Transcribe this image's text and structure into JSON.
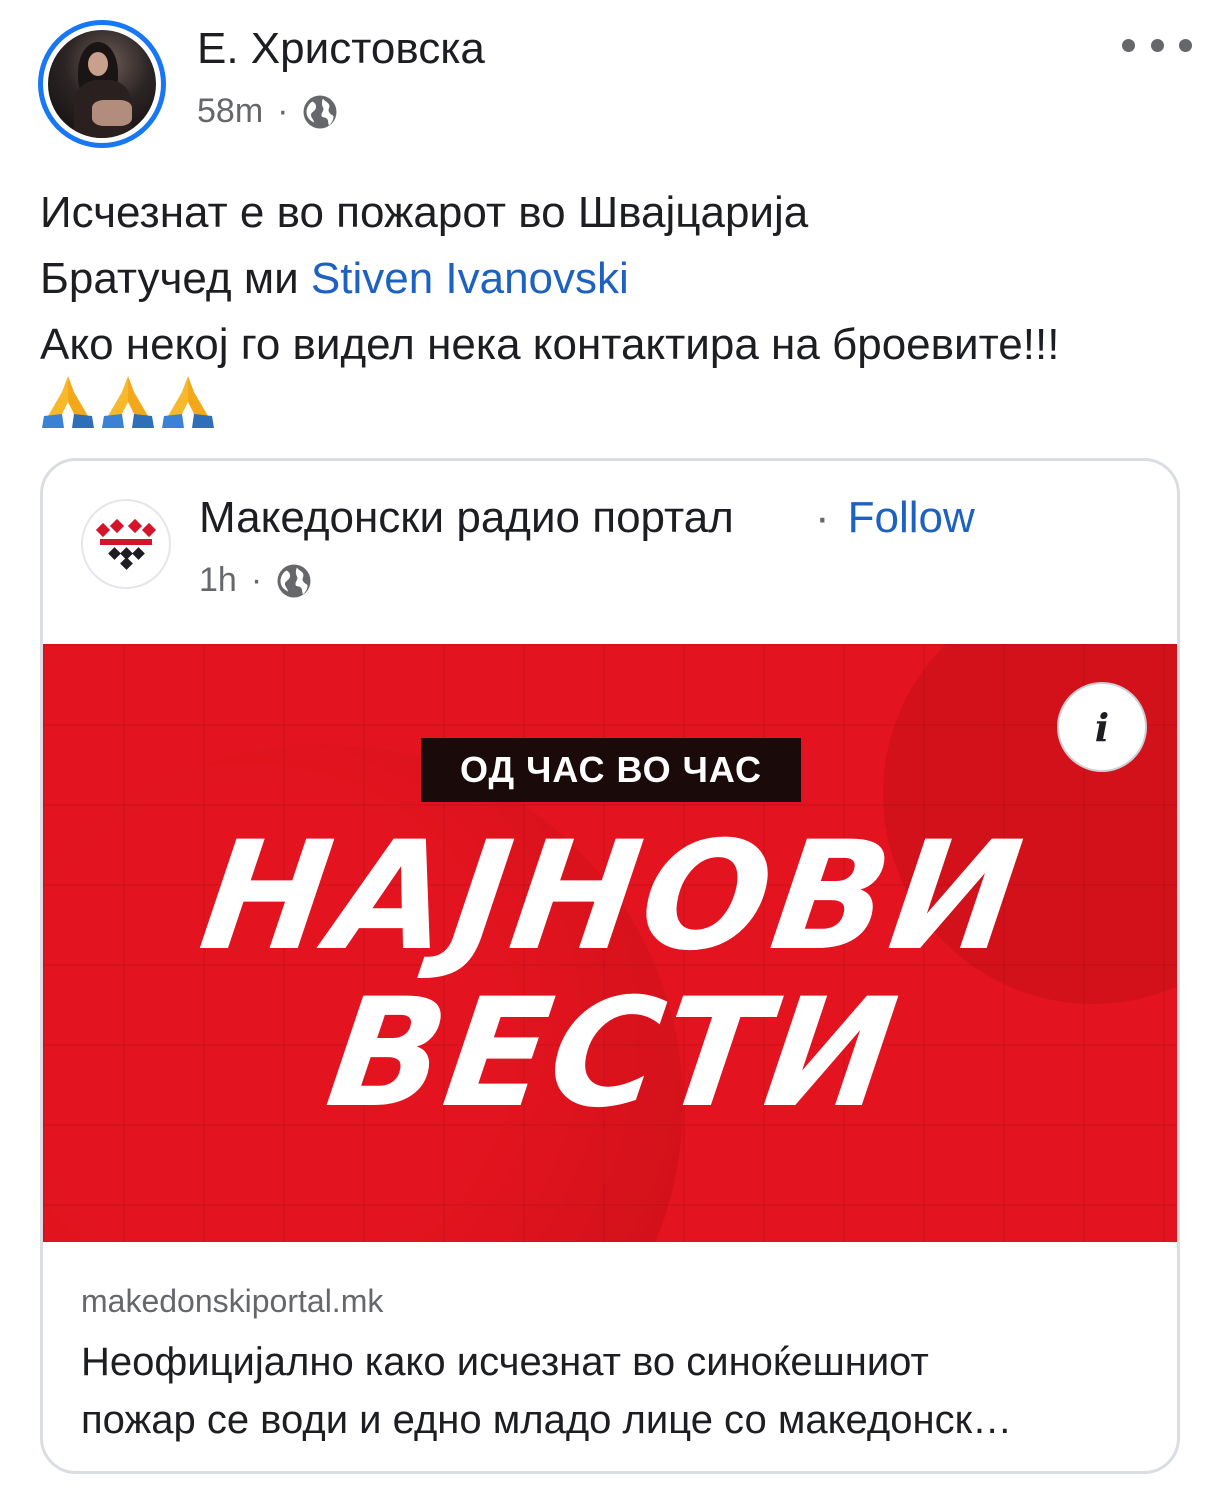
{
  "post": {
    "author": "Е. Христовска",
    "time": "58m",
    "separator": "·",
    "privacy_icon": "globe-icon",
    "more_icon": "more-horizontal-icon",
    "text_line_1": "Исчезнат е во пожарот во Швајцарија",
    "text_line_2_prefix": "Братучед ми ",
    "mention": "Stiven Ivanovski",
    "text_line_3": "Ако некој го видел нека контактира на броевите!!!",
    "emojis": [
      "🙏",
      "🙏",
      "🙏"
    ]
  },
  "shared": {
    "page_name": "Македонски радио портал",
    "follow_label": "Follow",
    "separator": "·",
    "time": "1h",
    "privacy_icon": "globe-icon",
    "banner": {
      "kicker": "ОД ЧАС ВО ЧАС",
      "headline_line_1": "НАЈНОВИ",
      "headline_line_2": "ВЕСТИ",
      "info_label": "i",
      "background_color": "#e3141f"
    },
    "link_domain": "makedonskiportal.mk",
    "link_title_line_1": "Неофицијално како исчезнат во синоќешниот",
    "link_title_line_2": "пожар се води и едно младо лице со македонск…"
  },
  "colors": {
    "accent": "#1877f2",
    "link": "#1d62c0",
    "secondary_text": "#65676b"
  }
}
